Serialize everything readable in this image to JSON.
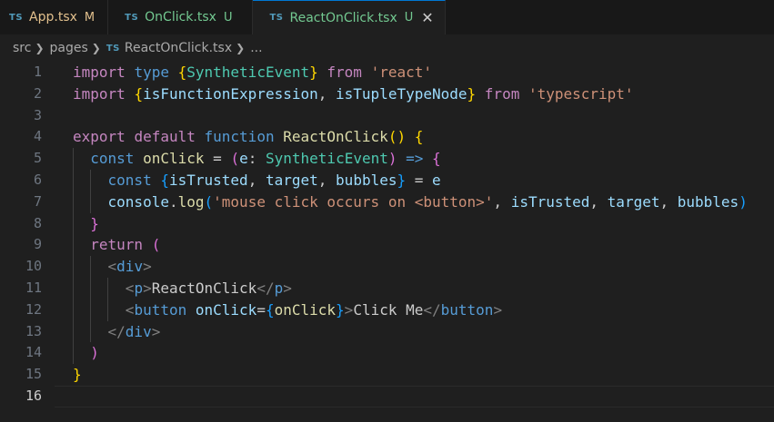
{
  "tabs": [
    {
      "lang": "TS",
      "name": "App.tsx",
      "status": "M",
      "color": "#e2c08d"
    },
    {
      "lang": "TS",
      "name": "OnClick.tsx",
      "status": "U",
      "color": "#73c991"
    },
    {
      "lang": "TS",
      "name": "ReactOnClick.tsx",
      "status": "U",
      "color": "#73c991",
      "active": true
    }
  ],
  "breadcrumb": {
    "folder1": "src",
    "folder2": "pages",
    "lang": "TS",
    "file": "ReactOnClick.tsx",
    "more": "..."
  },
  "editor": {
    "line_numbers": [
      "1",
      "2",
      "3",
      "4",
      "5",
      "6",
      "7",
      "8",
      "9",
      "10",
      "11",
      "12",
      "13",
      "14",
      "15",
      "16"
    ],
    "current_line": "16"
  }
}
